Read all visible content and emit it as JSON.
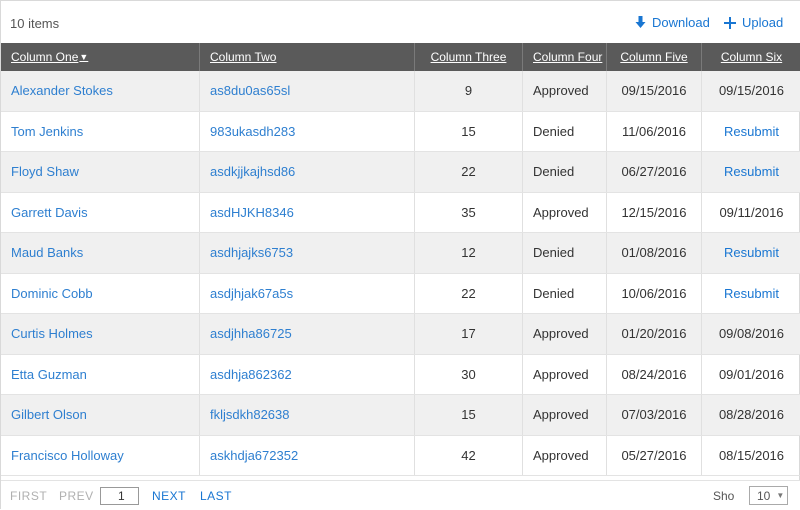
{
  "toolbar": {
    "item_count": "10 items",
    "download_label": "Download",
    "upload_label": "Upload",
    "download_icon": "download-arrow-icon",
    "upload_icon": "plus-icon"
  },
  "columns": [
    {
      "label": "Column One",
      "sorted": "desc"
    },
    {
      "label": "Column Two"
    },
    {
      "label": "Column Three"
    },
    {
      "label": "Column Four"
    },
    {
      "label": "Column Five"
    },
    {
      "label": "Column Six"
    }
  ],
  "rows": [
    {
      "name": "Alexander Stokes",
      "code": "as8du0as65sl",
      "num": "9",
      "status": "Approved",
      "date5": "09/15/2016",
      "col6": "09/15/2016",
      "col6_action": false
    },
    {
      "name": "Tom Jenkins",
      "code": "983ukasdh283",
      "num": "15",
      "status": "Denied",
      "date5": "11/06/2016",
      "col6": "Resubmit",
      "col6_action": true
    },
    {
      "name": "Floyd Shaw",
      "code": "asdkjjkajhsd86",
      "num": "22",
      "status": "Denied",
      "date5": "06/27/2016",
      "col6": "Resubmit",
      "col6_action": true
    },
    {
      "name": "Garrett Davis",
      "code": "asdHJKH8346",
      "num": "35",
      "status": "Approved",
      "date5": "12/15/2016",
      "col6": "09/11/2016",
      "col6_action": false
    },
    {
      "name": "Maud Banks",
      "code": "asdhjajks6753",
      "num": "12",
      "status": "Denied",
      "date5": "01/08/2016",
      "col6": "Resubmit",
      "col6_action": true
    },
    {
      "name": "Dominic Cobb",
      "code": "asdjhjak67a5s",
      "num": "22",
      "status": "Denied",
      "date5": "10/06/2016",
      "col6": "Resubmit",
      "col6_action": true
    },
    {
      "name": "Curtis Holmes",
      "code": "asdjhha86725",
      "num": "17",
      "status": "Approved",
      "date5": "01/20/2016",
      "col6": "09/08/2016",
      "col6_action": false
    },
    {
      "name": "Etta Guzman",
      "code": "asdhja862362",
      "num": "30",
      "status": "Approved",
      "date5": "08/24/2016",
      "col6": "09/01/2016",
      "col6_action": false
    },
    {
      "name": "Gilbert Olson",
      "code": "fkljsdkh82638",
      "num": "15",
      "status": "Approved",
      "date5": "07/03/2016",
      "col6": "08/28/2016",
      "col6_action": false
    },
    {
      "name": "Francisco Holloway",
      "code": "askhdja672352",
      "num": "42",
      "status": "Approved",
      "date5": "05/27/2016",
      "col6": "08/15/2016",
      "col6_action": false
    }
  ],
  "pager": {
    "first": "FIRST",
    "prev": "PREV",
    "page_value": "1",
    "next": "NEXT",
    "last": "LAST",
    "show_label": "Sho",
    "page_size": "10"
  },
  "colors": {
    "header_bg": "#5a5a5a",
    "link": "#2e7fd0",
    "accent": "#1976d2",
    "alt_row": "#f0f0f0"
  }
}
